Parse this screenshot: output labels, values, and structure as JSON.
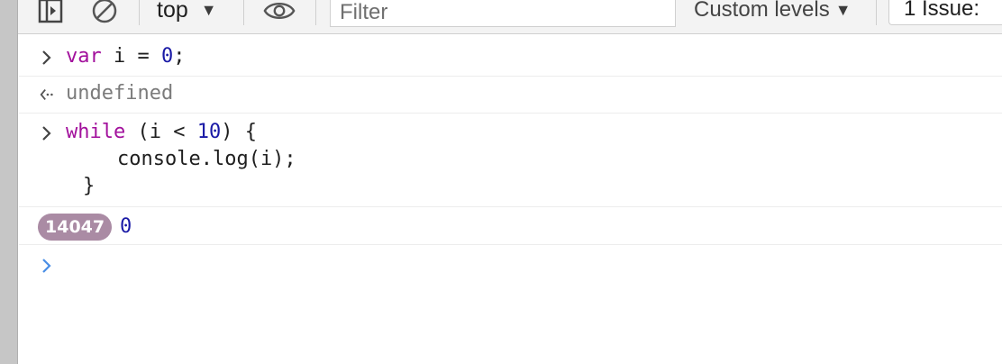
{
  "toolbar": {
    "context": "top",
    "filter_placeholder": "Filter",
    "levels_label": "Custom levels",
    "issues_label": "1 Issue:"
  },
  "console": {
    "entries": [
      {
        "type": "input",
        "tokens": [
          "var",
          " i = ",
          "0",
          ";"
        ]
      },
      {
        "type": "result",
        "text": "undefined"
      },
      {
        "type": "input",
        "tokens": [
          "while",
          " (i < ",
          "10",
          ") {"
        ],
        "line2": "console.log(i);",
        "line3": "}"
      },
      {
        "type": "log",
        "badge": "14047",
        "value": "0"
      }
    ]
  },
  "colors": {
    "keyword": "#a2109c",
    "number": "#1a1aa6",
    "badge_bg": "#aa8ba4",
    "prompt_active": "#4a8ee6"
  },
  "icons": [
    "sidebar-toggle-icon",
    "clear-console-icon",
    "eye-icon",
    "issue-flag-icon",
    "prompt-chevron-icon",
    "result-arrow-icon"
  ]
}
